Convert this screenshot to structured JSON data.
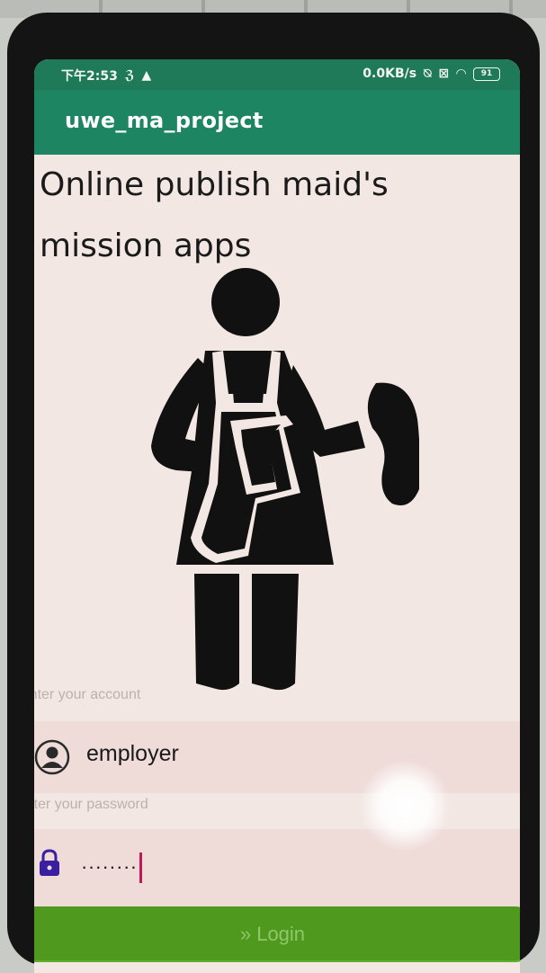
{
  "status_bar": {
    "time": "下午2:53",
    "network_speed": "0.0KB/s",
    "battery_level": "91"
  },
  "app_bar": {
    "title": "uwe_ma_project"
  },
  "headline": {
    "line1": "Online publish maid's",
    "line2": "mission apps"
  },
  "account": {
    "label": "Enter your account",
    "value": "employer"
  },
  "password": {
    "label": "Enter your password",
    "value": "········"
  },
  "login": {
    "icon_glyph": "»",
    "label": "Login"
  },
  "colors": {
    "app_bar": "#1d8562",
    "screen_background": "#f2e7e3",
    "input_background": "#efdcd9",
    "login_button": "#4f9a1e",
    "cursor": "#c2185b"
  }
}
